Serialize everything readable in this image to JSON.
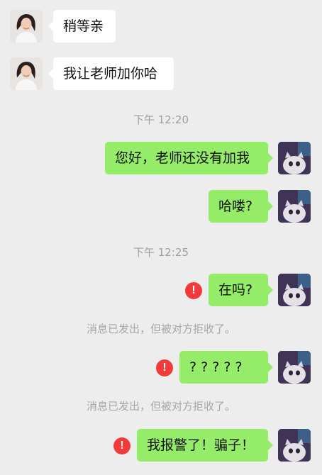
{
  "messages": {
    "m1": "稍等亲",
    "m2": "我让老师加你哈",
    "t1": "下午 12:20",
    "m3": "您好，老师还没有加我",
    "m4": "哈喽?",
    "t2": "下午 12:25",
    "m5": "在吗?",
    "n1": "消息已发出，但被对方拒收了。",
    "m6": "? ? ? ? ?",
    "n2": "消息已发出，但被对方拒收了。",
    "m7": "我报警了！骗子！"
  },
  "icons": {
    "error": "!"
  },
  "colors": {
    "background": "#EDEDED",
    "incoming_bubble": "#FFFFFF",
    "outgoing_bubble": "#95EC69",
    "error_badge": "#F23A3A",
    "timestamp_text": "#9E9E9E"
  }
}
